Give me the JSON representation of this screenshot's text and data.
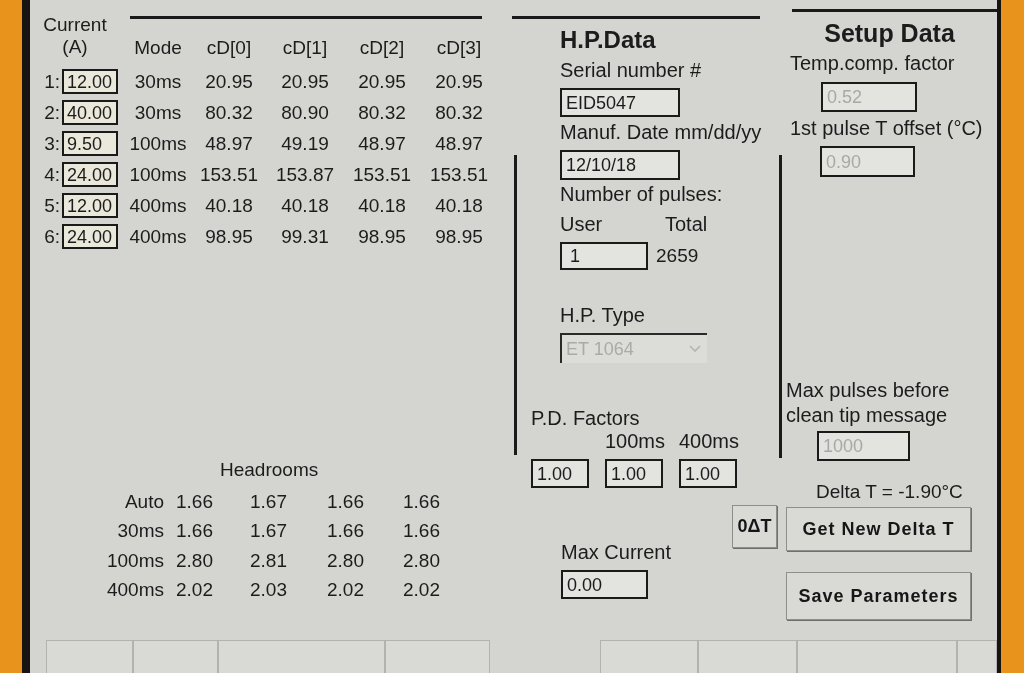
{
  "current_table": {
    "current_header": "Current (A)",
    "columns": [
      "Mode",
      "cD[0]",
      "cD[1]",
      "cD[2]",
      "cD[3]"
    ],
    "rows": [
      {
        "index": "1:",
        "current": "12.00",
        "mode": "30ms",
        "values": [
          "20.95",
          "20.95",
          "20.95",
          "20.95"
        ]
      },
      {
        "index": "2:",
        "current": "40.00",
        "mode": "30ms",
        "values": [
          "80.32",
          "80.90",
          "80.32",
          "80.32"
        ]
      },
      {
        "index": "3:",
        "current": "9.50",
        "mode": "100ms",
        "values": [
          "48.97",
          "49.19",
          "48.97",
          "48.97"
        ]
      },
      {
        "index": "4:",
        "current": "24.00",
        "mode": "100ms",
        "values": [
          "153.51",
          "153.87",
          "153.51",
          "153.51"
        ]
      },
      {
        "index": "5:",
        "current": "12.00",
        "mode": "400ms",
        "values": [
          "40.18",
          "40.18",
          "40.18",
          "40.18"
        ]
      },
      {
        "index": "6:",
        "current": "24.00",
        "mode": "400ms",
        "values": [
          "98.95",
          "99.31",
          "98.95",
          "98.95"
        ]
      }
    ]
  },
  "headrooms": {
    "title": "Headrooms",
    "rows": [
      {
        "mode": "Auto",
        "values": [
          "1.66",
          "1.67",
          "1.66",
          "1.66"
        ]
      },
      {
        "mode": "30ms",
        "values": [
          "1.66",
          "1.67",
          "1.66",
          "1.66"
        ]
      },
      {
        "mode": "100ms",
        "values": [
          "2.80",
          "2.81",
          "2.80",
          "2.80"
        ]
      },
      {
        "mode": "400ms",
        "values": [
          "2.02",
          "2.03",
          "2.02",
          "2.02"
        ]
      }
    ]
  },
  "hp_data": {
    "title": "H.P.Data",
    "serial": {
      "label": "Serial number #",
      "value": "EID5047",
      "disabled": false
    },
    "manuf_date": {
      "label": "Manuf. Date mm/dd/yy",
      "value": "12/10/18",
      "disabled": false
    },
    "pulses": {
      "label": "Number of pulses:",
      "user_label": "User",
      "total_label": "Total",
      "user": {
        "value": "1",
        "disabled": false
      },
      "total": "2659"
    },
    "hp_type": {
      "label": "H.P. Type",
      "value": "ET 1064",
      "disabled": true
    }
  },
  "pd_factors": {
    "label": "P.D. Factors",
    "fields": [
      {
        "value": "1.00",
        "disabled": false
      },
      {
        "heading": "100ms",
        "value": "1.00",
        "disabled": false
      },
      {
        "heading": "400ms",
        "value": "1.00",
        "disabled": false
      }
    ]
  },
  "max_current": {
    "label": "Max Current",
    "value": "0.00",
    "disabled": false
  },
  "setup_data": {
    "title": "Setup Data",
    "temp_comp": {
      "label": "Temp.comp. factor",
      "value": "0.52",
      "disabled": true
    },
    "pulse_offset": {
      "label": "1st pulse T offset (°C)",
      "value": "0.90",
      "disabled": true
    },
    "max_pulses": {
      "label": "Max pulses before clean tip message",
      "value": "1000",
      "disabled": true
    },
    "delta_t": "Delta T = -1.90°C"
  },
  "buttons": {
    "zero_delta_t": "0ΔT",
    "get_new_delta_t": "Get New Delta T",
    "save_parameters": "Save Parameters"
  }
}
